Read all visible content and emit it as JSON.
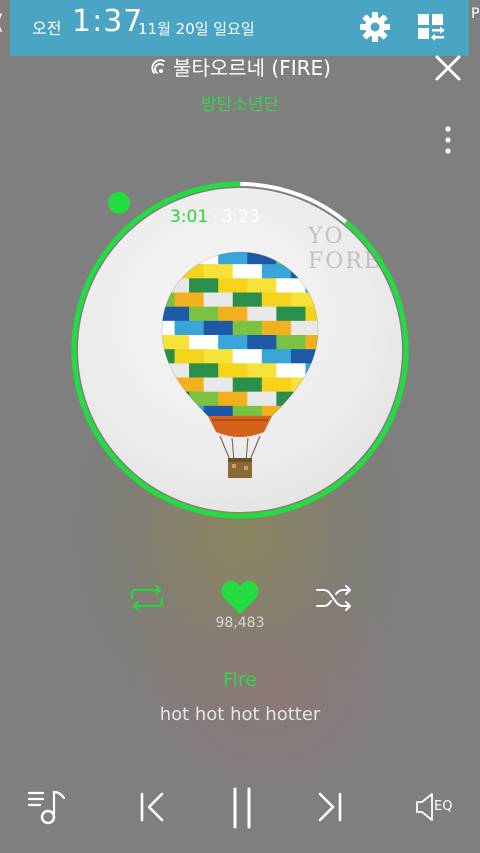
{
  "status_bar": {
    "ampm": "오전",
    "time": "1:37",
    "date": "11월 20일 일요일"
  },
  "player": {
    "song_title": "불타오르네 (FIRE)",
    "artist": "방탄소년단",
    "elapsed": "3:01",
    "separator": "·",
    "total": "3:23",
    "progress": 0.89,
    "like_count": "98,483",
    "lyric_title": "Fire",
    "lyric_line": "hot hot hot hotter",
    "eq_label": "EQ"
  },
  "colors": {
    "accent_green": "#22dd3f",
    "status_bar_bg": "#4aa4c4",
    "background": "#7f7f7f"
  },
  "icons": {
    "settings": "gear-icon",
    "view_toggle": "grid-swap-icon",
    "close": "close-icon",
    "more": "more-vertical-icon",
    "repeat": "repeat-icon",
    "like": "heart-icon",
    "shuffle": "shuffle-icon",
    "playlist": "playlist-icon",
    "previous": "skip-previous-icon",
    "pause": "pause-icon",
    "next": "skip-next-icon",
    "equalizer": "equalizer-icon"
  }
}
